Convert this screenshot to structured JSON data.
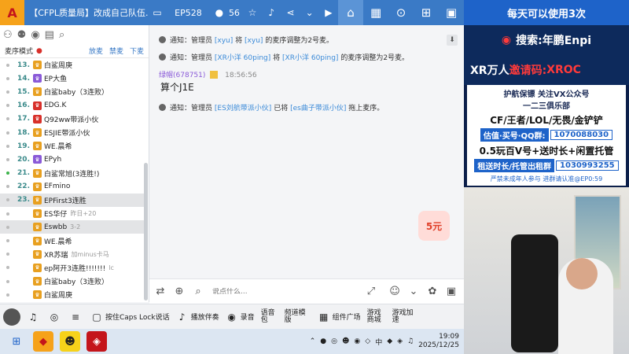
{
  "title": {
    "logo": "A",
    "room": "【CFPL质量局】改成自己队伍...",
    "ep": "EP528",
    "viewers": "56"
  },
  "nav": [
    "home-icon",
    "grid-icon",
    "gamepad-icon",
    "cart-icon",
    "more-icon"
  ],
  "mode": {
    "label": "麦序模式",
    "links": [
      "放麦",
      "禁麦",
      "下麦"
    ]
  },
  "list": [
    {
      "num": "13.",
      "name": "白鲨周庚",
      "badge": "#e8a020",
      "sel": false,
      "dot": "gray"
    },
    {
      "num": "14.",
      "name": "EP大鱼",
      "badge": "#8a5ad8",
      "sel": false,
      "dot": "gray"
    },
    {
      "num": "15.",
      "name": "白鲨baby（3连败）",
      "badge": "#e8a020",
      "sel": false,
      "dot": "gray"
    },
    {
      "num": "16.",
      "name": "EDG.K",
      "badge": "#d8302a",
      "sel": false,
      "dot": "gray"
    },
    {
      "num": "17.",
      "name": "Q92ww带派小伙",
      "badge": "#d8302a",
      "sel": false,
      "dot": "gray"
    },
    {
      "num": "18.",
      "name": "ESJIE带派小伙",
      "badge": "#e8a020",
      "sel": false,
      "dot": "gray"
    },
    {
      "num": "19.",
      "name": "WE.晨希",
      "badge": "#e8a020",
      "sel": false,
      "dot": "gray"
    },
    {
      "num": "20.",
      "name": "EPyh",
      "badge": "#8a5ad8",
      "sel": false,
      "dot": "gray"
    },
    {
      "num": "21.",
      "name": "白鲨常旭(3连胜!)",
      "badge": "#e8a020",
      "sel": false,
      "dot": "green"
    },
    {
      "num": "22.",
      "name": "EFmino",
      "badge": "#e8a020",
      "sel": false,
      "dot": "gray"
    },
    {
      "num": "23.",
      "name": "EPFirst3连胜",
      "badge": "#e8a020",
      "sel": true,
      "dot": "gray"
    },
    {
      "num": "",
      "name": "ES华仔",
      "badge": "#e8a020",
      "sel": false,
      "dot": "gray",
      "extra": "昨日+20"
    },
    {
      "num": "",
      "name": "Eswbb",
      "badge": "#e8a020",
      "sel": true,
      "dot": "gray",
      "extra": "3-2"
    },
    {
      "num": "",
      "name": "WE.晨希",
      "badge": "#e8a020",
      "sel": false,
      "dot": "gray"
    },
    {
      "num": "",
      "name": "XR苏瑞",
      "badge": "#e8a020",
      "sel": false,
      "dot": "gray",
      "extra": "加minus卡马"
    },
    {
      "num": "",
      "name": "ep阿开3连胜!!!!!!!",
      "badge": "#e8a020",
      "sel": false,
      "dot": "gray",
      "extra": "lc"
    },
    {
      "num": "",
      "name": "白鲨baby（3连败）",
      "badge": "#e8a020",
      "sel": false,
      "dot": "gray"
    },
    {
      "num": "",
      "name": "白鲨周庚",
      "badge": "#e8a020",
      "sel": false,
      "dot": "gray"
    }
  ],
  "messages": {
    "m1": {
      "p1": "通知：管理员",
      "a": "[xyu]",
      "p2": "将",
      "b": "[xyu]",
      "p3": "的麦序调整为2号麦。"
    },
    "m2": {
      "p1": "通知：管理员",
      "a": "[XR小洋 60ping]",
      "p2": "将",
      "b": "[XR小洋 60ping]",
      "p3": "的麦序调整为2号麦。"
    },
    "user": {
      "name": "绿帽(678751)",
      "time": "18:56:56",
      "text": "算个J1E"
    },
    "m3": {
      "p1": "通知：管理员",
      "a": "[ES刘航带派小伙]",
      "p2": "已将",
      "b": "[es曲子带派小伙]",
      "p3": "拖上麦序。"
    }
  },
  "gift": "5元",
  "input": {
    "placeholder": "说点什么..."
  },
  "toolbar": {
    "capslock": "按住Caps Lock说话",
    "accompany": "播放伴奏",
    "record": "录音",
    "voice": "语音包",
    "template": "频道模版",
    "plugin": "组件广场",
    "mall": "游戏商城",
    "accel": "游戏加速"
  },
  "taskbar": {
    "lang": "中",
    "time": "19:09",
    "date": "2025/12/25"
  },
  "side": {
    "l1": "每天可以使用3次",
    "l2": "搜索:年鹏Enpi",
    "l3a": "XR万人",
    "l3b": "邀请码:",
    "l3c": "XROC",
    "c1": "护航保镖 关注VX公众号",
    "c2": "一二三俱乐部",
    "c3": "CF/王者/LOL/无畏/金铲铲",
    "p1": "估值·买号·QQ群:",
    "v1": "1070088030",
    "c4": "0.5玩百V号+送时长+闲置托管",
    "p2": "租送时长/托管出租群",
    "v2": "1030993255",
    "warn": "严禁未成年人参与 进群请认准@EP0:59"
  },
  "colors": {
    "accent": "#3a7ac6",
    "title": "#3a7ac6",
    "side": "#0c1f4a"
  }
}
